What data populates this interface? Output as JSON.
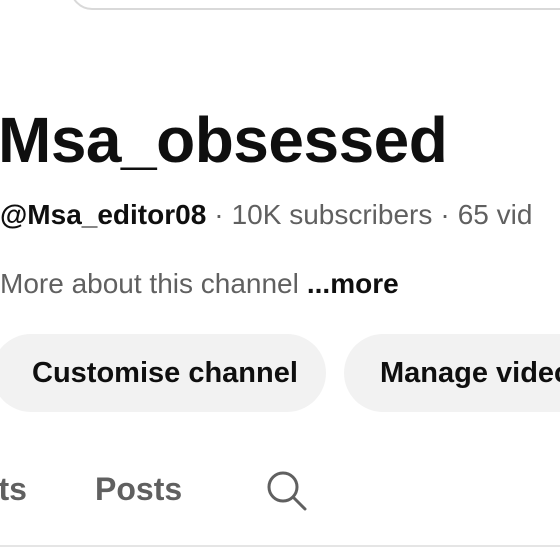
{
  "header": {
    "search_box": {}
  },
  "channel": {
    "name": "Msa_obsessed",
    "handle": "@Msa_editor08",
    "separator": "·",
    "subscribers": "10K subscribers",
    "videos": "65 vid",
    "about": "More about this channel",
    "more_label": "...more"
  },
  "actions": {
    "customise_label": "Customise channel",
    "manage_label": "Manage videc"
  },
  "tabs": {
    "items": [
      {
        "label": "rts"
      },
      {
        "label": "Posts"
      }
    ],
    "search_icon": "search-icon"
  },
  "colors": {
    "text_primary": "#0f0f0f",
    "text_secondary": "#606060",
    "pill_bg": "#f2f2f2",
    "border": "#d9d9d9"
  }
}
